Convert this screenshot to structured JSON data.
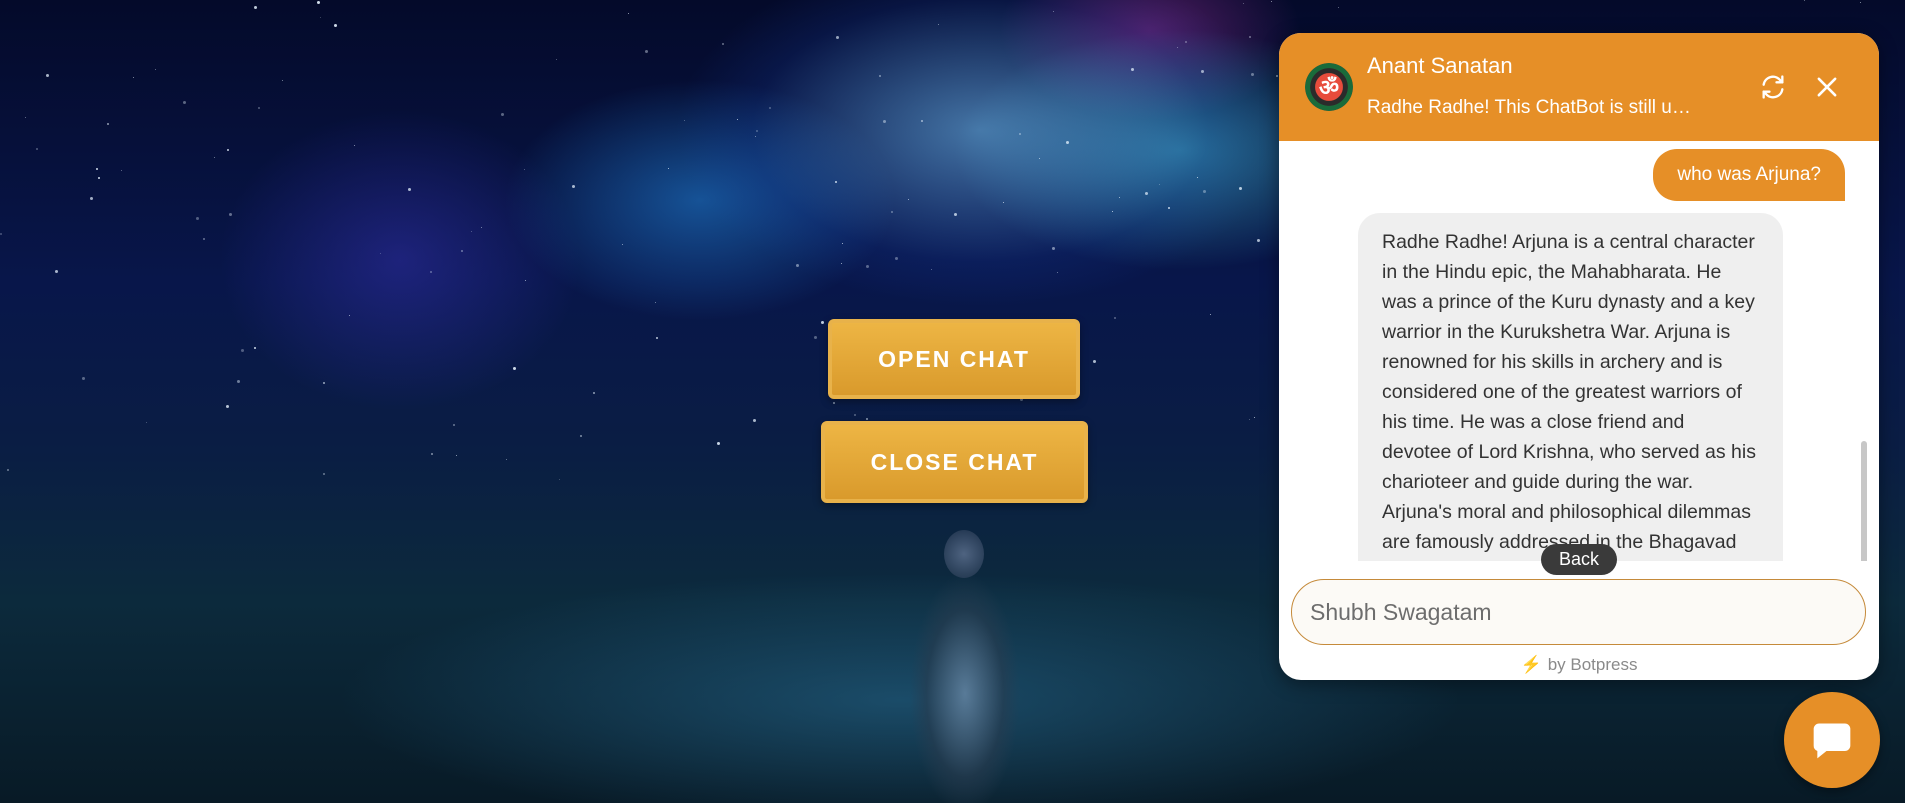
{
  "page": {
    "open_chat_label": "OPEN CHAT",
    "close_chat_label": "CLOSE CHAT"
  },
  "chat": {
    "title": "Anant Sanatan",
    "description": "Radhe Radhe! This ChatBot is still u…",
    "avatar_glyph": "ॐ",
    "refresh_icon": "refresh-icon",
    "close_icon": "close-icon",
    "messages": [
      {
        "from": "user",
        "text": "who was Arjuna?"
      },
      {
        "from": "bot",
        "text": "Radhe Radhe! Arjuna is a central character in the Hindu epic, the Mahabharata. He was a prince of the Kuru dynasty and a key warrior in the Kurukshetra War. Arjuna is renowned for his skills in archery and is considered one of the greatest warriors of his time. He was a close friend and devotee of Lord Krishna, who served as his charioteer and guide during the war. Arjuna's moral and philosophical dilemmas are famously addressed in the Bhagavad"
      }
    ],
    "back_label": "Back",
    "input_placeholder": "Shubh Swagatam",
    "powered_by": "by Botpress"
  },
  "colors": {
    "accent": "#e68f27",
    "button_gold": "#e0a535"
  }
}
